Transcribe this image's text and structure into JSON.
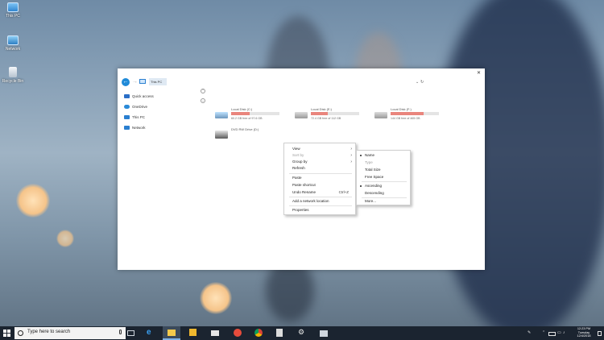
{
  "desktop": {
    "icons": [
      {
        "label": "This PC",
        "icon": "pc-icon"
      },
      {
        "label": "Network",
        "icon": "network-icon"
      },
      {
        "label": "Recycle Bin",
        "icon": "recycle-bin-icon"
      }
    ]
  },
  "window": {
    "address": "This PC",
    "nav": [
      {
        "label": "Quick access",
        "icon": "star-icon",
        "color": "#2b6fc7"
      },
      {
        "label": "OneDrive",
        "icon": "cloud-icon",
        "color": "#2a8ad8"
      },
      {
        "label": "This PC",
        "icon": "pc-icon",
        "color": "#2a7fd0"
      },
      {
        "label": "Network",
        "icon": "network-icon",
        "color": "#2a7fd0"
      }
    ],
    "drives": [
      {
        "name": "Local Disk (C:)",
        "free": "60.2 GB free of 97.6 GB",
        "used_fraction": 0.38
      },
      {
        "name": "Local Disk (E:)",
        "free": "72.4 GB free of 112 GB",
        "used_fraction": 0.35
      },
      {
        "name": "Local Disk (F:)",
        "free": "144 GB free of 465 GB",
        "used_fraction": 0.69
      },
      {
        "name": "DVD RW Drive (D:)"
      }
    ]
  },
  "context_menu": {
    "items": [
      {
        "label": "View",
        "has_submenu": true
      },
      {
        "label": "Sort by",
        "has_submenu": true,
        "disabled": true
      },
      {
        "label": "Group by",
        "has_submenu": true
      },
      {
        "label": "Refresh"
      },
      {
        "label": "Paste"
      },
      {
        "label": "Paste shortcut"
      },
      {
        "label": "Undo Rename",
        "shortcut": "Ctrl+Z"
      },
      {
        "label": "Add a network location"
      },
      {
        "label": "Properties"
      }
    ]
  },
  "sort_submenu": {
    "items": [
      {
        "label": "Name",
        "selected": true
      },
      {
        "label": "Type",
        "disabled": true
      },
      {
        "label": "Total Size"
      },
      {
        "label": "Free Space"
      },
      {
        "label": "Ascending",
        "selected": true
      },
      {
        "label": "Descending"
      },
      {
        "label": "More..."
      }
    ]
  },
  "taskbar": {
    "search_placeholder": "Type here to search",
    "clock_time": "12:23 PM",
    "clock_day": "Tuesday",
    "clock_date": "12/4/2018",
    "accent": "#7fb2e6"
  }
}
